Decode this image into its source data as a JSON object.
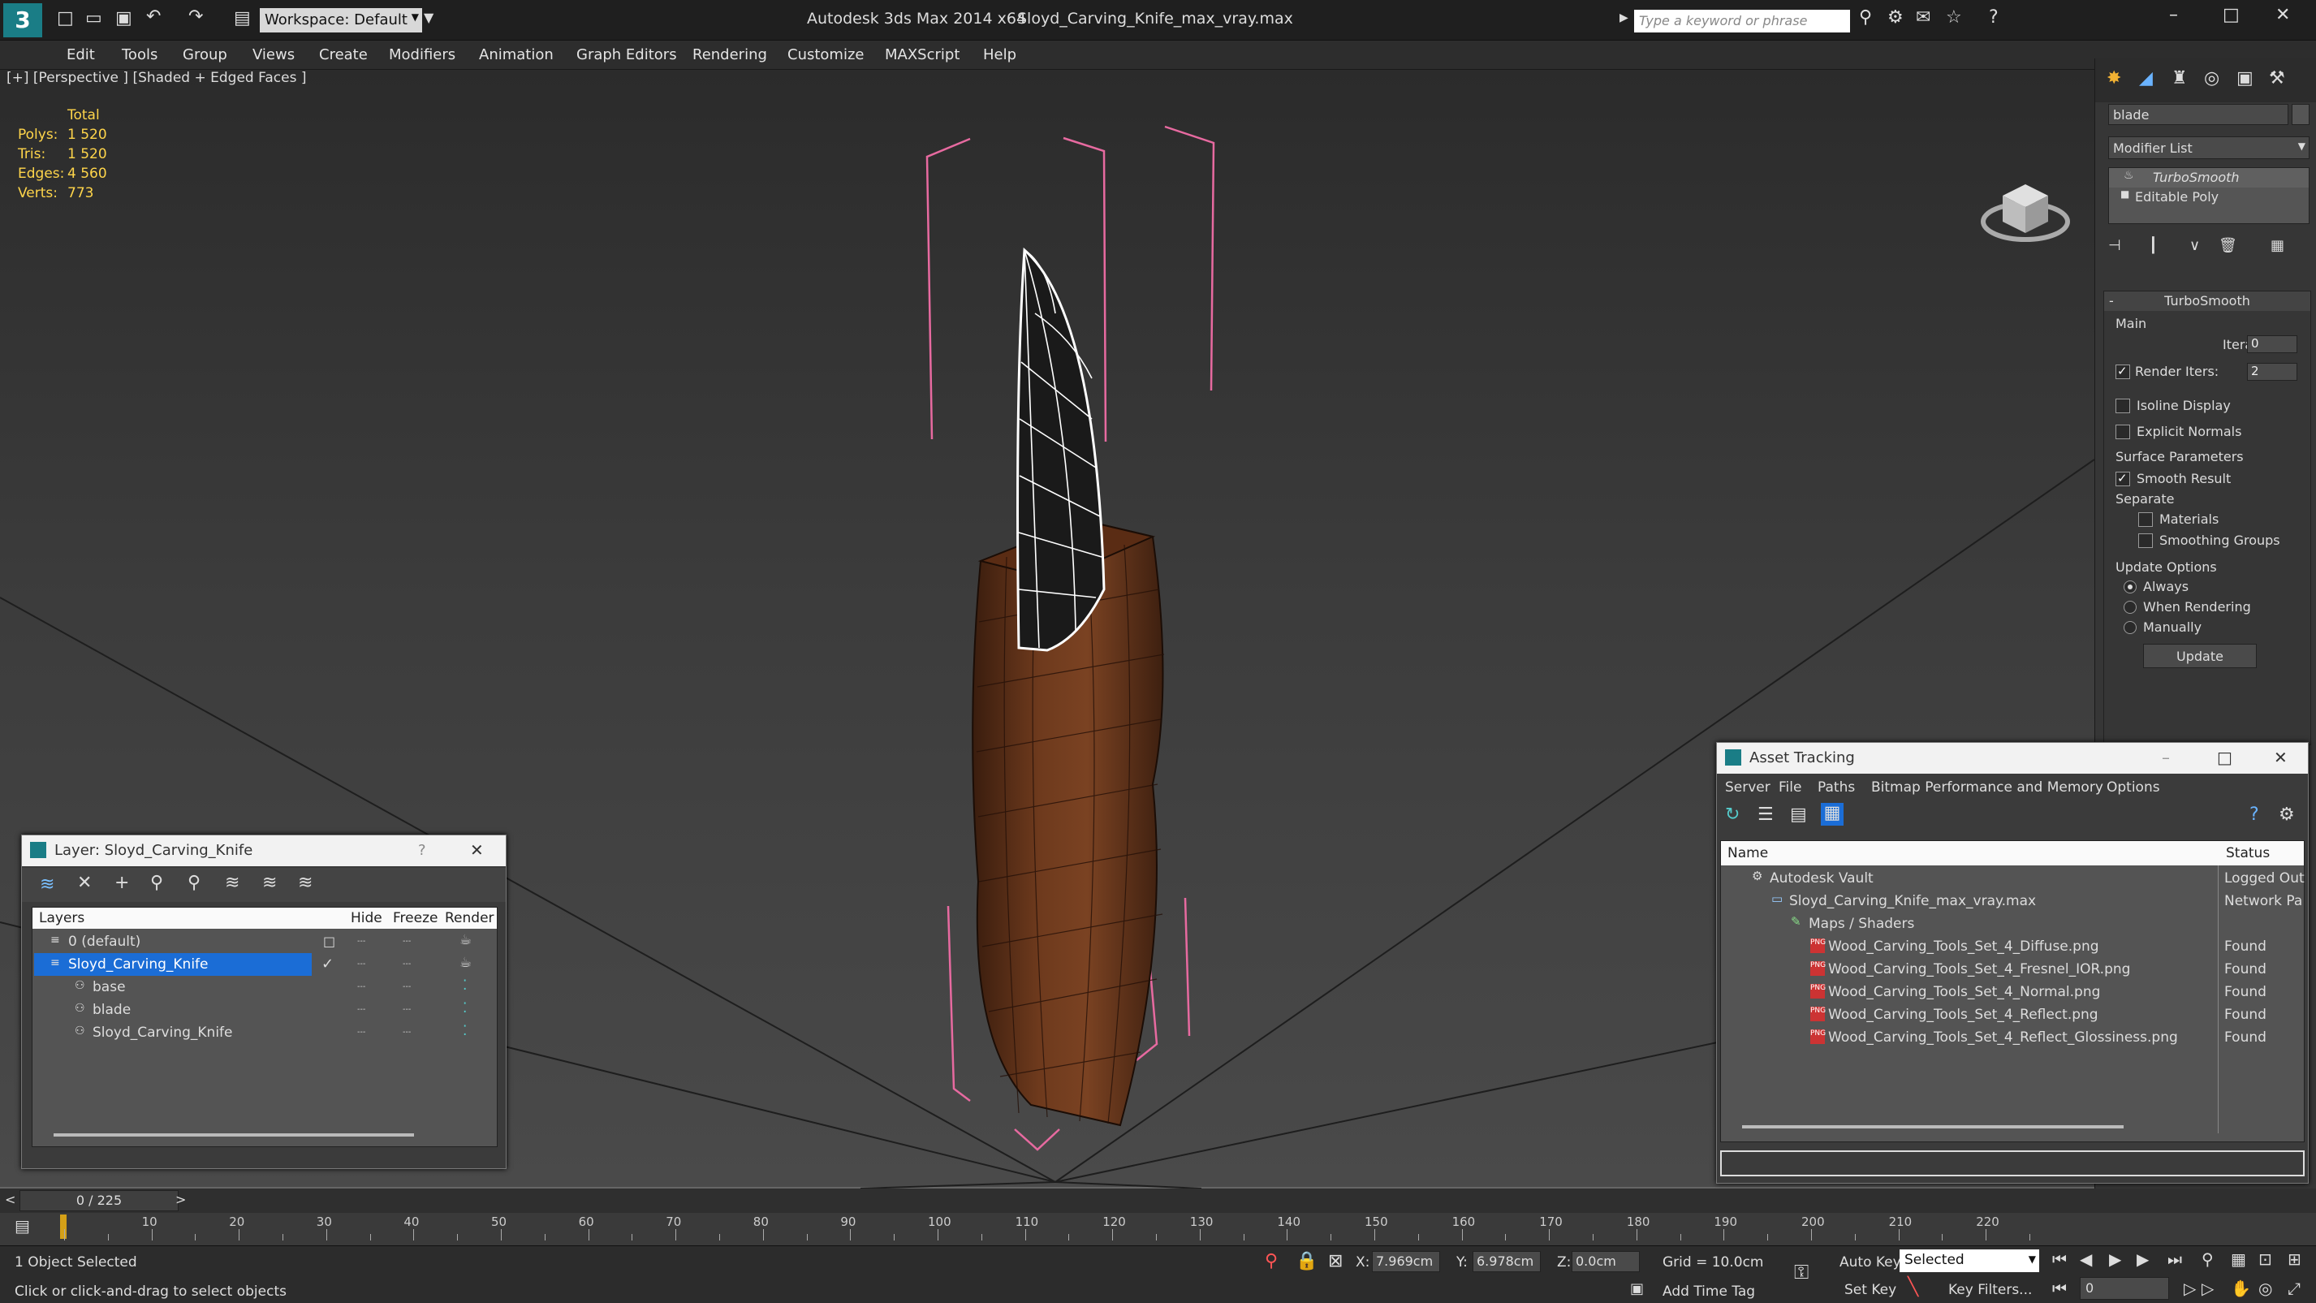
{
  "titlebar": {
    "workspace_label": "Workspace: Default",
    "app_title": "Autodesk 3ds Max  2014 x64",
    "file_title": "Sloyd_Carving_Knife_max_vray.max",
    "search_placeholder": "Type a keyword or phrase"
  },
  "menu": [
    "Edit",
    "Tools",
    "Group",
    "Views",
    "Create",
    "Modifiers",
    "Animation",
    "Graph Editors",
    "Rendering",
    "Customize",
    "MAXScript",
    "Help"
  ],
  "viewport": {
    "label": "[+] [Perspective ] [Shaded + Edged Faces ]",
    "stats": {
      "total_label": "Total",
      "rows": [
        {
          "label": "Polys:",
          "value": "1 520"
        },
        {
          "label": "Tris:",
          "value": "1 520"
        },
        {
          "label": "Edges:",
          "value": "4 560"
        },
        {
          "label": "Verts:",
          "value": "773"
        }
      ]
    }
  },
  "command_panel": {
    "object_name": "blade",
    "modifier_list": "Modifier List",
    "stack": [
      "TurboSmooth",
      "Editable Poly"
    ],
    "rollout_title": "TurboSmooth",
    "main_group": "Main",
    "iterations_label": "Iterations:",
    "iterations_value": "0",
    "render_iters_label": "Render Iters:",
    "render_iters_value": "2",
    "isoline_label": "Isoline Display",
    "explicit_label": "Explicit Normals",
    "surface_group": "Surface Parameters",
    "smooth_result_label": "Smooth Result",
    "separate_label": "Separate",
    "materials_label": "Materials",
    "smoothing_groups_label": "Smoothing Groups",
    "update_group": "Update Options",
    "always_label": "Always",
    "when_rendering_label": "When Rendering",
    "manually_label": "Manually",
    "update_button": "Update"
  },
  "layer_window": {
    "title": "Layer: Sloyd_Carving_Knife",
    "help": "?",
    "columns": [
      "Layers",
      "Hide",
      "Freeze",
      "Render"
    ],
    "rows": [
      {
        "name": "0 (default)",
        "indent": 0,
        "selected": false
      },
      {
        "name": "Sloyd_Carving_Knife",
        "indent": 0,
        "selected": true
      },
      {
        "name": "base",
        "indent": 1,
        "selected": false
      },
      {
        "name": "blade",
        "indent": 1,
        "selected": false
      },
      {
        "name": "Sloyd_Carving_Knife",
        "indent": 1,
        "selected": false
      }
    ]
  },
  "asset_window": {
    "title": "Asset Tracking",
    "menu": [
      "Server",
      "File",
      "Paths",
      "Bitmap Performance and Memory",
      "Options"
    ],
    "columns": [
      "Name",
      "Status"
    ],
    "rows": [
      {
        "name": "Autodesk Vault",
        "status": "Logged Out",
        "indent": 1
      },
      {
        "name": "Sloyd_Carving_Knife_max_vray.max",
        "status": "Network Pa",
        "indent": 2
      },
      {
        "name": "Maps / Shaders",
        "status": "",
        "indent": 3
      },
      {
        "name": "Wood_Carving_Tools_Set_4_Diffuse.png",
        "status": "Found",
        "indent": 4
      },
      {
        "name": "Wood_Carving_Tools_Set_4_Fresnel_IOR.png",
        "status": "Found",
        "indent": 4
      },
      {
        "name": "Wood_Carving_Tools_Set_4_Normal.png",
        "status": "Found",
        "indent": 4
      },
      {
        "name": "Wood_Carving_Tools_Set_4_Reflect.png",
        "status": "Found",
        "indent": 4
      },
      {
        "name": "Wood_Carving_Tools_Set_4_Reflect_Glossiness.png",
        "status": "Found",
        "indent": 4
      }
    ]
  },
  "timeline": {
    "frame_display": "0 / 225",
    "ticks": [
      "10",
      "20",
      "30",
      "40",
      "50",
      "60",
      "70",
      "80",
      "90",
      "100",
      "110",
      "120",
      "130",
      "140",
      "150",
      "160",
      "170",
      "180",
      "190",
      "200",
      "210",
      "220"
    ]
  },
  "status": {
    "selection": "1 Object Selected",
    "prompt": "Click or click-and-drag to select objects",
    "x_label": "X:",
    "x_value": "7.969cm",
    "y_label": "Y:",
    "y_value": "6.978cm",
    "z_label": "Z:",
    "z_value": "0.0cm",
    "grid": "Grid = 10.0cm",
    "auto_key": "Auto Key",
    "set_key": "Set Key",
    "selected_dropdown": "Selected",
    "key_filters": "Key Filters...",
    "add_time_tag": "Add Time Tag",
    "frame_value": "0"
  }
}
